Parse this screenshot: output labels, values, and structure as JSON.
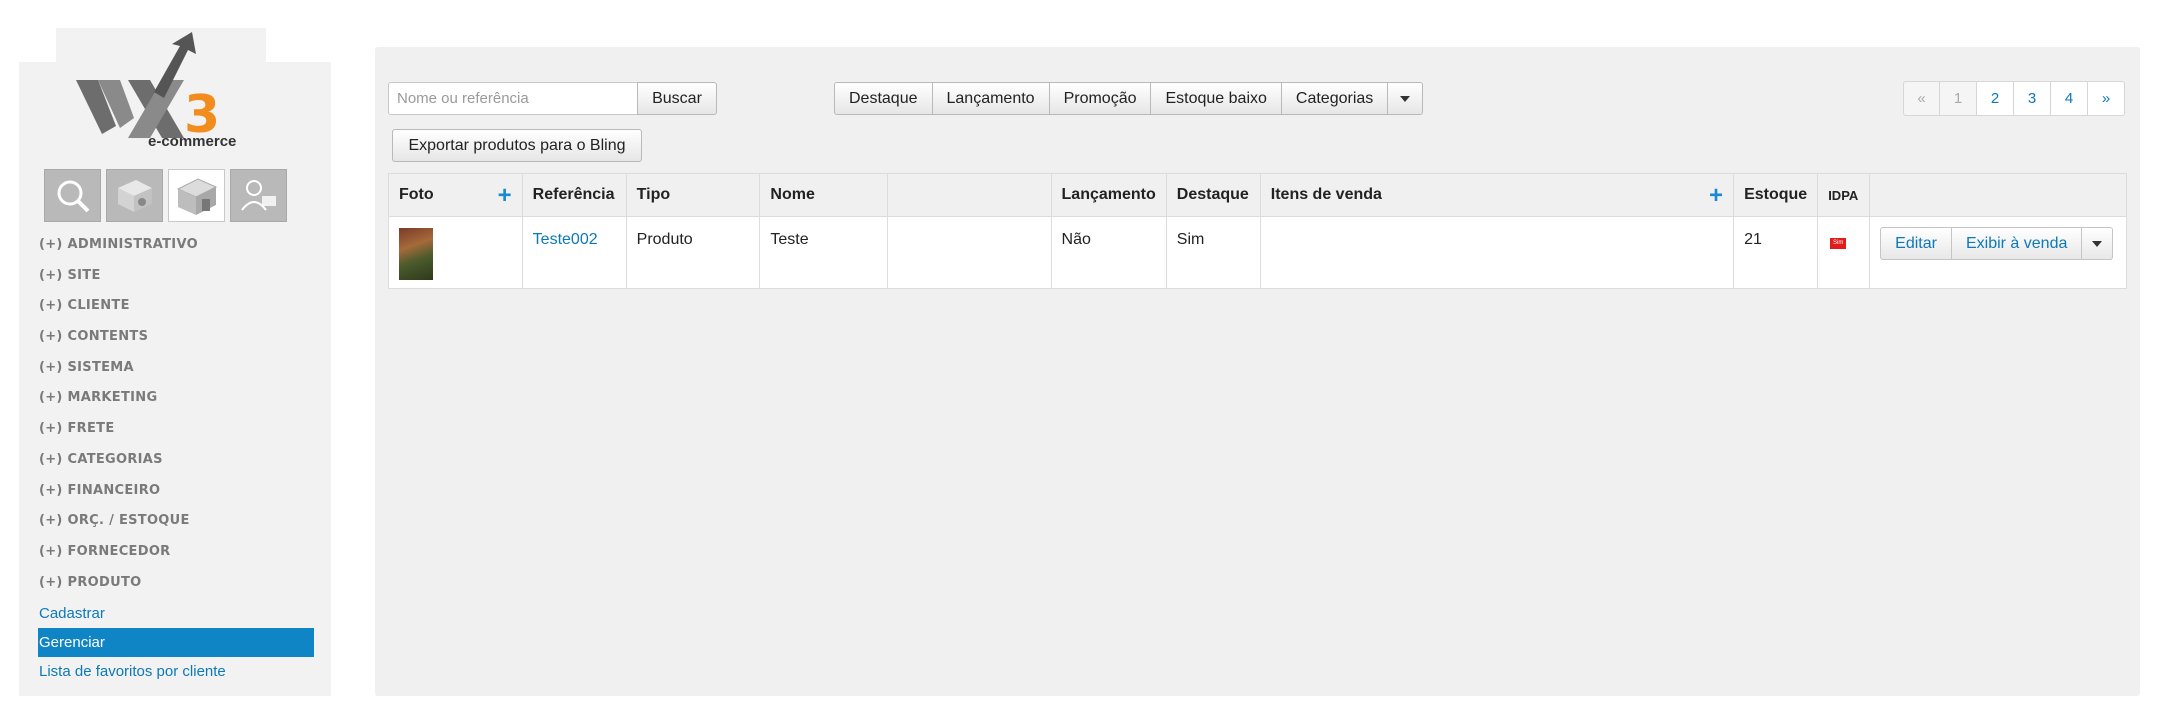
{
  "brand": {
    "logo_text": "vx3",
    "logo_subtitle": "e-commerce",
    "accent_color": "#f28c1d"
  },
  "quick_icons": [
    {
      "icon": "search-magnifier-icon",
      "active": false
    },
    {
      "icon": "box-icon",
      "active": false
    },
    {
      "icon": "store-icon",
      "active": true
    },
    {
      "icon": "user-card-icon",
      "active": false
    }
  ],
  "sidebar": {
    "menu": [
      "(+) ADMINISTRATIVO",
      "(+) SITE",
      "(+) CLIENTE",
      "(+) CONTENTS",
      "(+) SISTEMA",
      "(+) MARKETING",
      "(+) FRETE",
      "(+) CATEGORIAS",
      "(+) FINANCEIRO",
      "(+) ORÇ. / ESTOQUE",
      "(+) FORNECEDOR",
      "(+) PRODUTO"
    ],
    "submenu": [
      "Cadastrar",
      "Gerenciar",
      "Lista de favoritos por cliente"
    ],
    "active_submenu": "Gerenciar"
  },
  "toolbar": {
    "search_placeholder": "Nome ou referência",
    "search_value": "",
    "search_button": "Buscar",
    "filters": [
      "Destaque",
      "Lançamento",
      "Promoção",
      "Estoque baixo",
      "Categorias"
    ],
    "export_button": "Exportar produtos para o Bling"
  },
  "pagination": {
    "prev": "«",
    "pages": [
      "1",
      "2",
      "3",
      "4"
    ],
    "current": "1",
    "next": "»"
  },
  "table": {
    "headers": {
      "foto": "Foto",
      "referencia": "Referência",
      "tipo": "Tipo",
      "nome": "Nome",
      "blank": "",
      "lancamento": "Lançamento",
      "destaque": "Destaque",
      "itens": "Itens de venda",
      "estoque": "Estoque",
      "idpa": "IDPA",
      "acoes": ""
    },
    "rows": [
      {
        "referencia": "Teste002",
        "tipo": "Produto",
        "nome": "Teste",
        "lancamento": "Não",
        "destaque": "Sim",
        "itens": "",
        "estoque": "21",
        "idpa": "Sim",
        "edit": "Editar",
        "show": "Exibir à venda"
      }
    ]
  }
}
